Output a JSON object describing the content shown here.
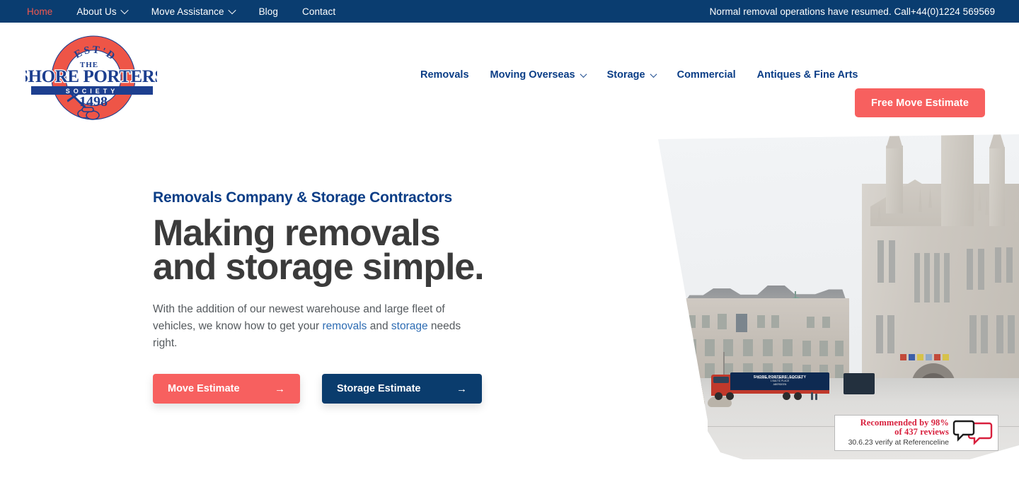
{
  "topbar": {
    "nav": [
      {
        "label": "Home",
        "active": true,
        "has_dropdown": false
      },
      {
        "label": "About Us",
        "active": false,
        "has_dropdown": true
      },
      {
        "label": "Move Assistance",
        "active": false,
        "has_dropdown": true
      },
      {
        "label": "Blog",
        "active": false,
        "has_dropdown": false
      },
      {
        "label": "Contact",
        "active": false,
        "has_dropdown": false
      }
    ],
    "notice": "Normal removal operations have resumed. Call+44(0)1224 569569",
    "background_color": "#0a3d70",
    "active_color": "#f2584f"
  },
  "logo": {
    "ring_top_text": "EST'D",
    "ring_bottom_text": "1498",
    "the": "THE",
    "name": "SHORE PORTERS",
    "society": "S O C I E T Y",
    "ring_color": "#ee5547",
    "text_color": "#1d3f8f"
  },
  "mainnav": {
    "items": [
      {
        "label": "Removals",
        "has_dropdown": false
      },
      {
        "label": "Moving Overseas",
        "has_dropdown": true
      },
      {
        "label": "Storage",
        "has_dropdown": true
      },
      {
        "label": "Commercial",
        "has_dropdown": false
      },
      {
        "label": "Antiques & Fine Arts",
        "has_dropdown": false
      }
    ],
    "cta_label": "Free Move Estimate",
    "link_color": "#0a3d86",
    "cta_color": "#f7605f"
  },
  "hero": {
    "eyebrow": "Removals Company & Storage Contractors",
    "headline_line1": "Making removals",
    "headline_line2": "and storage simple.",
    "subcopy_part1": "With the addition of our newest warehouse and large fleet of vehicles, we know how to get your ",
    "subcopy_link1": "removals",
    "subcopy_part2": " and ",
    "subcopy_link2": "storage",
    "subcopy_part3": " needs right.",
    "primary_button": "Move Estimate",
    "secondary_button": "Storage Estimate",
    "arrow_glyph": "→",
    "headline_color": "#3b3b3b",
    "eyebrow_color": "#0a3d86"
  },
  "hero_image": {
    "lorry_name": "SHORE PORTERS' SOCIETY",
    "lorry_sub_line1": "REMOVAL & STORAGE CONTRACTORS",
    "lorry_sub_line2": "1 BALTIC PLACE",
    "lorry_sub_line3": "ABERDEEN"
  },
  "badge": {
    "line1": "Recommended by 98%",
    "line2": "of 437 reviews",
    "line3": "30.6.23 verify at Referenceline",
    "accent_color": "#d81f3c"
  }
}
